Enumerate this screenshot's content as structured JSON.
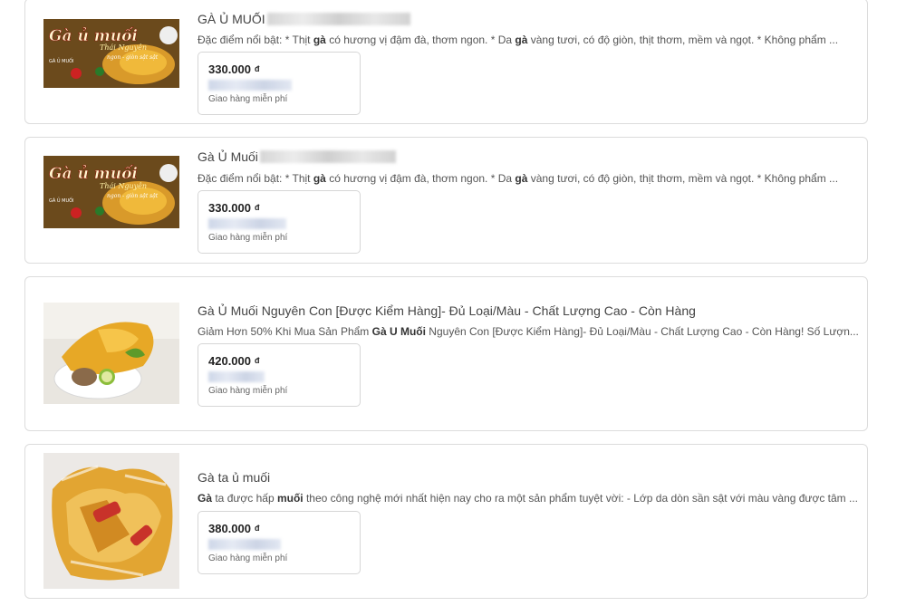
{
  "results": [
    {
      "title": "GÀ Ủ MUỐI",
      "desc_parts": [
        "Đặc điểm nổi bật: * Thịt ",
        "gà",
        " có hương vị đậm đà, thơm ngon. * Da ",
        "gà",
        " vàng tươi, có độ giòn, thịt thơm, mềm và ngọt. * Không phẩm ..."
      ],
      "price": "330.000",
      "currency": "đ",
      "shipping": "Giao hàng miễn phí",
      "image": "ga-u-muoi-banner-icon"
    },
    {
      "title": "Gà Ủ Muối",
      "desc_parts": [
        "Đặc điểm nổi bật: * Thịt ",
        "gà",
        " có hương vị đậm đà, thơm ngon. * Da ",
        "gà",
        " vàng tươi, có độ giòn, thịt thơm, mềm và ngọt. * Không phẩm ..."
      ],
      "price": "330.000",
      "currency": "đ",
      "shipping": "Giao hàng miễn phí",
      "image": "ga-u-muoi-banner-icon"
    },
    {
      "title": "Gà Ủ Muối Nguyên Con [Được Kiểm Hàng]- Đủ Loại/Màu - Chất Lượng Cao - Còn Hàng",
      "desc_parts": [
        "Giảm Hơn 50% Khi Mua Sản Phẩm ",
        "Gà U Muối",
        " Nguyên Con [Được Kiểm Hàng]- Đủ Loại/Màu - Chất Lượng Cao - Còn Hàng! Số Lượn..."
      ],
      "price": "420.000",
      "currency": "đ",
      "shipping": "Giao hàng miễn phí",
      "image": "chicken-plate-photo-icon"
    },
    {
      "title": "Gà ta ủ muối",
      "desc_parts": [
        "Gà",
        " ta được hấp ",
        "muối",
        " theo công nghệ mới nhất hiện nay cho ra một sản phẩm tuyệt vời: - Lớp da dòn sần sật với màu vàng được tâm ..."
      ],
      "price": "380.000",
      "currency": "đ",
      "shipping": "Giao hàng miễn phí",
      "image": "packaged-chicken-photo-icon"
    }
  ],
  "banner": {
    "line1": "Gà ủ muối",
    "line2": "Thái Nguyên",
    "line3": "ngon - giòn sật sật",
    "brand": "GÀ Ủ MUỐI"
  }
}
